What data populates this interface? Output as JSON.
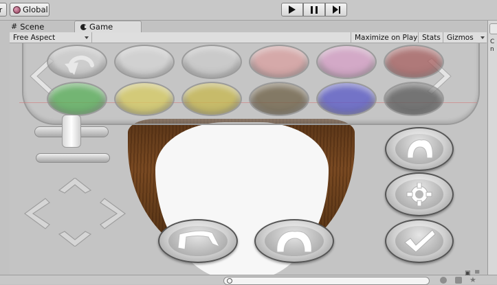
{
  "toolbar": {
    "pivot_label": "r",
    "global_label": "Global",
    "play_icon": "play-icon",
    "pause_icon": "pause-icon",
    "step_icon": "step-icon"
  },
  "tabs": [
    {
      "label": "Scene",
      "icon": "grid-icon"
    },
    {
      "label": "Game",
      "icon": "game-icon"
    }
  ],
  "right_strip": {
    "text": "C\nn"
  },
  "game_bar": {
    "aspect": "Free Aspect",
    "maximize": "Maximize on Play",
    "stats": "Stats",
    "gizmos": "Gizmos"
  },
  "palette": {
    "top_row": [
      "#d0d0d0",
      "#d6d6d6",
      "#cccccc",
      "#dba0a0",
      "#d8a0c8",
      "#a86060"
    ],
    "bottom_row": [
      "#58b058",
      "#d8cc60",
      "#c8b84c",
      "#6e6045",
      "#5858c8",
      "#5a5a5a"
    ]
  },
  "buttons": {
    "hairstyle_right": "hairstyle-icon",
    "settings": "gear-icon",
    "confirm": "checkmark-icon",
    "hair_left": "hair-shape-left-icon",
    "hair_center": "hair-shape-center-icon"
  },
  "colors": {
    "editor_bg": "#c2c2c2",
    "hair": "#6b4220"
  }
}
